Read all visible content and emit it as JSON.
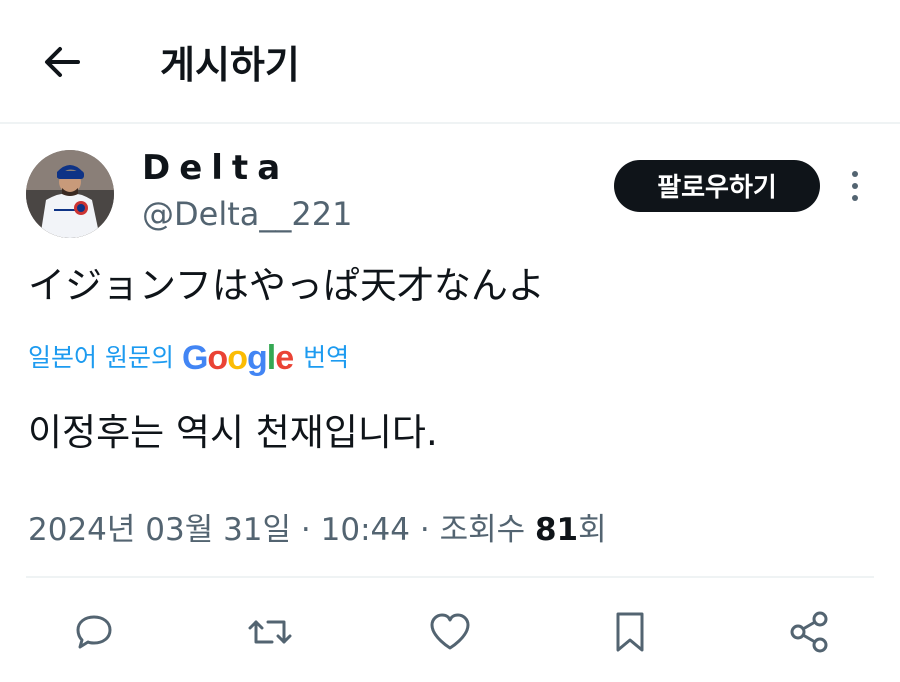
{
  "header": {
    "title": "게시하기"
  },
  "user": {
    "name": "Delta",
    "handle": "@Delta__221"
  },
  "follow_label": "팔로우하기",
  "tweet": {
    "text": "イジョンフはやっぱ天才なんよ",
    "translate_prefix": "일본어 원문의",
    "translate_brand": [
      "G",
      "o",
      "o",
      "g",
      "l",
      "e"
    ],
    "translate_suffix": "번역",
    "translated_text": "이정후는 역시 천재입니다."
  },
  "meta": {
    "date": "2024년 03월 31일",
    "sep": "·",
    "time": "10:44",
    "views_label": "조회수",
    "views": "81",
    "views_unit": "회"
  },
  "colors": {
    "accent": "#1d9bf0",
    "muted": "#536471",
    "text": "#0f1419",
    "google": [
      "#4285F4",
      "#EA4335",
      "#FBBC05",
      "#4285F4",
      "#34A853",
      "#EA4335"
    ]
  },
  "icons": {
    "back": "arrow-left-icon",
    "more": "more-vertical-icon",
    "reply": "reply-icon",
    "retweet": "retweet-icon",
    "like": "heart-icon",
    "bookmark": "bookmark-icon",
    "share": "share-icon"
  }
}
